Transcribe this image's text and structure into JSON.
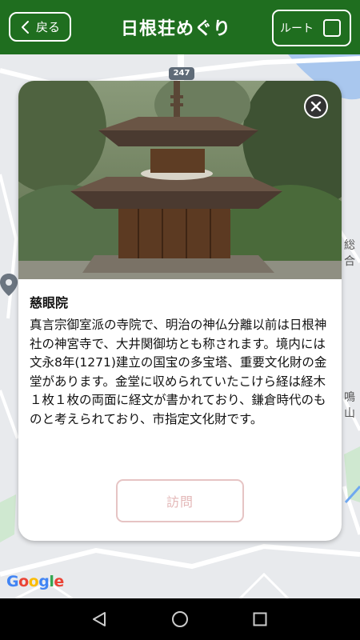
{
  "header": {
    "back_label": "戻る",
    "title": "日根荘めぐり",
    "route_label": "ルート"
  },
  "map": {
    "route_number": "247",
    "label_right_1": "総合",
    "label_right_2": "鳴山",
    "logo": "Google"
  },
  "card": {
    "place_name": "慈眼院",
    "description": "真言宗御室派の寺院で、明治の神仏分離以前は日根神社の神宮寺で、大井関御坊とも称されます。境内には文永8年(1271)建立の国宝の多宝塔、重要文化財の金堂があります。金堂に収められていたこけら経は経木１枚１枚の両面に経文が書かれており、鎌倉時代のものと考えられており、市指定文化財です。",
    "visit_label": "訪問"
  },
  "colors": {
    "header_bg": "#1f6e1f",
    "visit_border": "#e6c4c4"
  },
  "icons": {
    "back": "chevron-left-icon",
    "close": "close-icon",
    "pin": "map-pin-icon",
    "nav_back": "triangle-back-icon",
    "nav_home": "circle-home-icon",
    "nav_recents": "square-recents-icon"
  }
}
